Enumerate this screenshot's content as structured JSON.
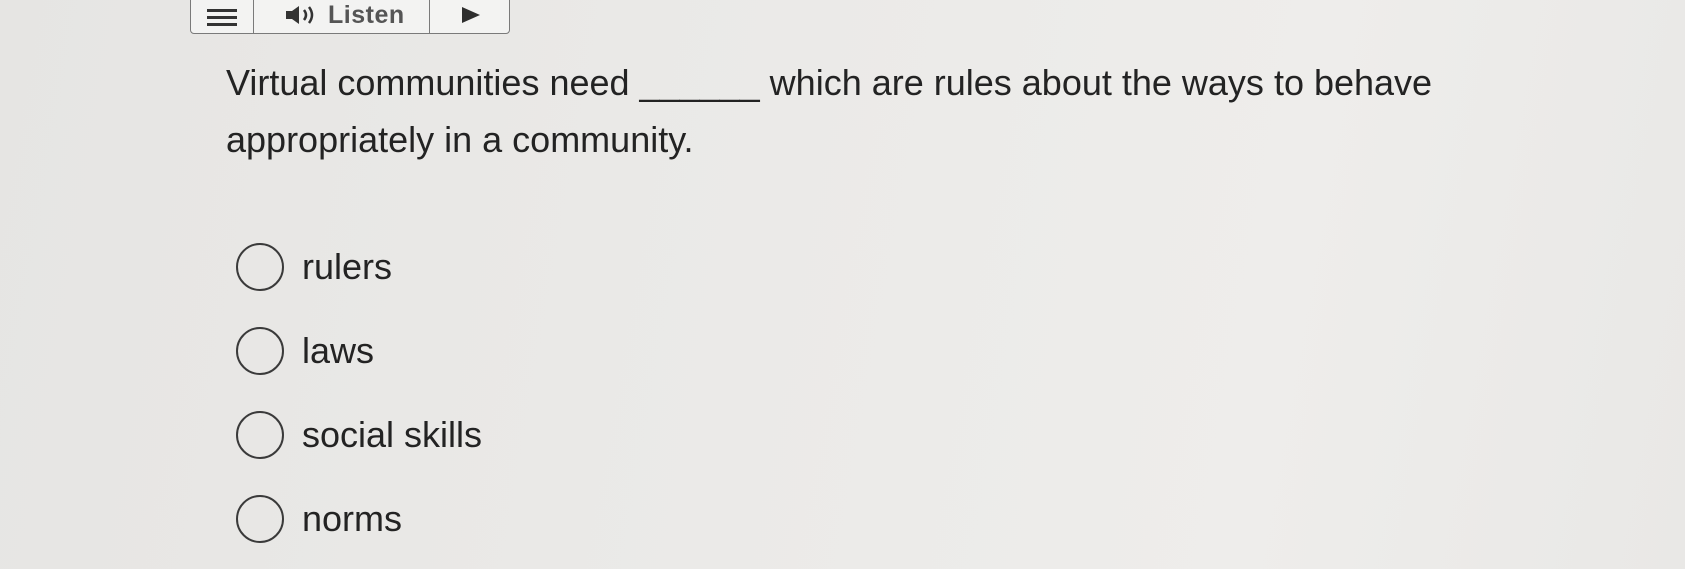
{
  "toolbar": {
    "menu_icon": "hamburger-menu-icon",
    "listen_icon": "speaker-icon",
    "listen_label": "Listen",
    "play_icon": "play-icon"
  },
  "question": {
    "text": "Virtual communities need ______ which are rules about the ways to behave appropriately in a community."
  },
  "options": [
    {
      "label": "rulers",
      "selected": false
    },
    {
      "label": "laws",
      "selected": false
    },
    {
      "label": "social skills",
      "selected": false
    },
    {
      "label": "norms",
      "selected": false
    }
  ]
}
